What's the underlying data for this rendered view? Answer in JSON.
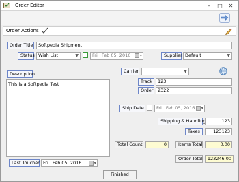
{
  "window": {
    "title": "Order Editor",
    "minimize_glyph": "–",
    "maximize_glyph": "□",
    "close_glyph": "✕"
  },
  "actions": {
    "label": "Order Actions"
  },
  "order": {
    "title_label": "Order Title",
    "title_value": "Softpedia Shipment",
    "status_label": "Status",
    "status_value": "Wish List",
    "status_date_day": "Fri",
    "status_date_value": "Feb 05, 2016",
    "supplier_label": "Supplier",
    "supplier_value": "Default",
    "description_label": "Description",
    "description_value": "This is a Softpedia Test",
    "carrier_label": "Carrier",
    "carrier_value": "",
    "track_label": "Track",
    "track_value": "123",
    "order_label": "Order",
    "order_value": "2322",
    "ship_date_label": "Ship Date",
    "ship_date_day": "Fri",
    "ship_date_value": "Feb 05, 2016",
    "shipping_label": "Shipping & Handling",
    "shipping_value": "123",
    "taxes_label": "Taxes",
    "taxes_value": "123123",
    "total_count_label": "Total Count",
    "total_count_value": "0",
    "items_total_label": "Items Total",
    "items_total_value": "0.00",
    "last_touched_label": "Last Touched",
    "last_touched_day": "Fri",
    "last_touched_value": "Feb 05, 2016",
    "order_total_label": "Order Total",
    "order_total_value": "123246.00"
  },
  "footer": {
    "finished_label": "Finished"
  },
  "icons": {
    "app": "order-editor-icon",
    "forward": "forward-arrow-icon",
    "actions": "check-list-icon",
    "edit": "pencil-icon",
    "calendar": "calendar-icon",
    "carrier_lookup": "globe-icon"
  },
  "colors": {
    "label_border": "#6d86c8",
    "field_highlight": "#fdfbd2",
    "checkbox_border": "#3a9a3a"
  }
}
